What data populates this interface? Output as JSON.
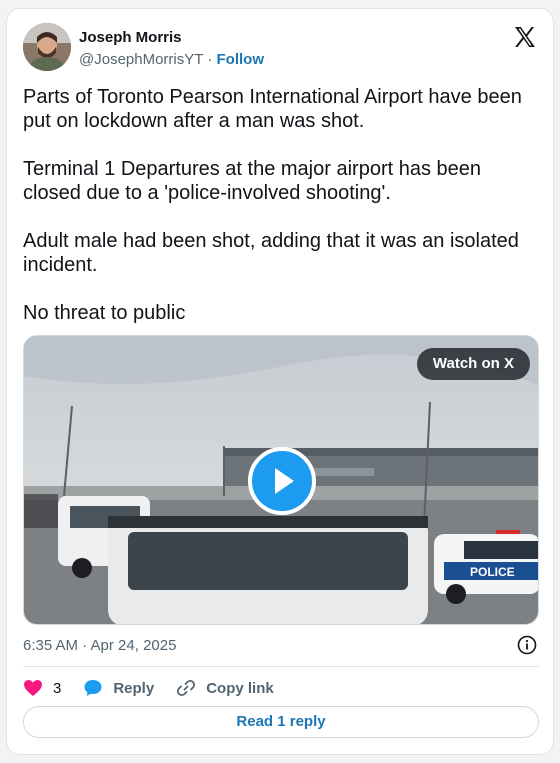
{
  "author": {
    "name": "Joseph Morris",
    "handle": "@JosephMorrisYT",
    "separator": "·",
    "follow_label": "Follow"
  },
  "tweet": {
    "paragraphs": [
      "Parts of Toronto Pearson International Airport have been put on lockdown after a man was shot.",
      "Terminal 1 Departures at the major airport has been closed due to a 'police-involved shooting'.",
      "Adult male had been shot, adding that it was an isolated incident.",
      "No threat to public"
    ]
  },
  "media": {
    "watch_label": "Watch on X",
    "police_car_text": "POLICE"
  },
  "timestamp": "6:35 AM · Apr 24, 2025",
  "actions": {
    "like_count": "3",
    "reply_label": "Reply",
    "copy_link_label": "Copy link"
  },
  "read_replies_label": "Read 1 reply",
  "colors": {
    "accent": "#1d9bf0",
    "link": "#1d76b6",
    "like": "#f91880",
    "muted": "#536471"
  },
  "icons": [
    "x-logo-icon",
    "play-icon",
    "info-icon",
    "heart-icon",
    "speech-bubble-icon",
    "link-icon"
  ]
}
